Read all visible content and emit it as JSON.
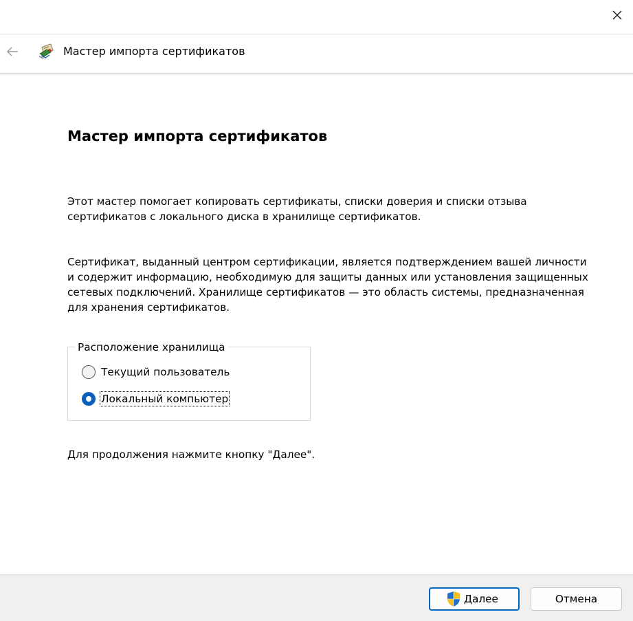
{
  "window": {
    "close_icon": "close-icon"
  },
  "nav": {
    "back_icon": "back-arrow-icon",
    "wizard_icon": "certificate-wizard-icon",
    "title": "Мастер импорта сертификатов"
  },
  "content": {
    "title": "Мастер импорта сертификатов",
    "paragraph1": "Этот мастер помогает копировать сертификаты, списки доверия и списки отзыва сертификатов с локального диска в хранилище сертификатов.",
    "paragraph2": "Сертификат, выданный центром сертификации, является подтверждением вашей личности и содержит информацию, необходимую для защиты данных или установления защищенных сетевых подключений. Хранилище сертификатов — это область системы, предназначенная для хранения сертификатов.",
    "store_location": {
      "legend": "Расположение хранилища",
      "options": [
        {
          "label": "Текущий пользователь",
          "checked": false
        },
        {
          "label": "Локальный компьютер",
          "checked": true
        }
      ]
    },
    "continue_hint": "Для продолжения нажмите кнопку \"Далее\"."
  },
  "footer": {
    "next_label": "Далее",
    "next_icon": "uac-shield-icon",
    "cancel_label": "Отмена"
  },
  "colors": {
    "accent": "#0067c0",
    "radio_checked": "#0a5fb8",
    "footer_bg": "#f0f0f0"
  }
}
